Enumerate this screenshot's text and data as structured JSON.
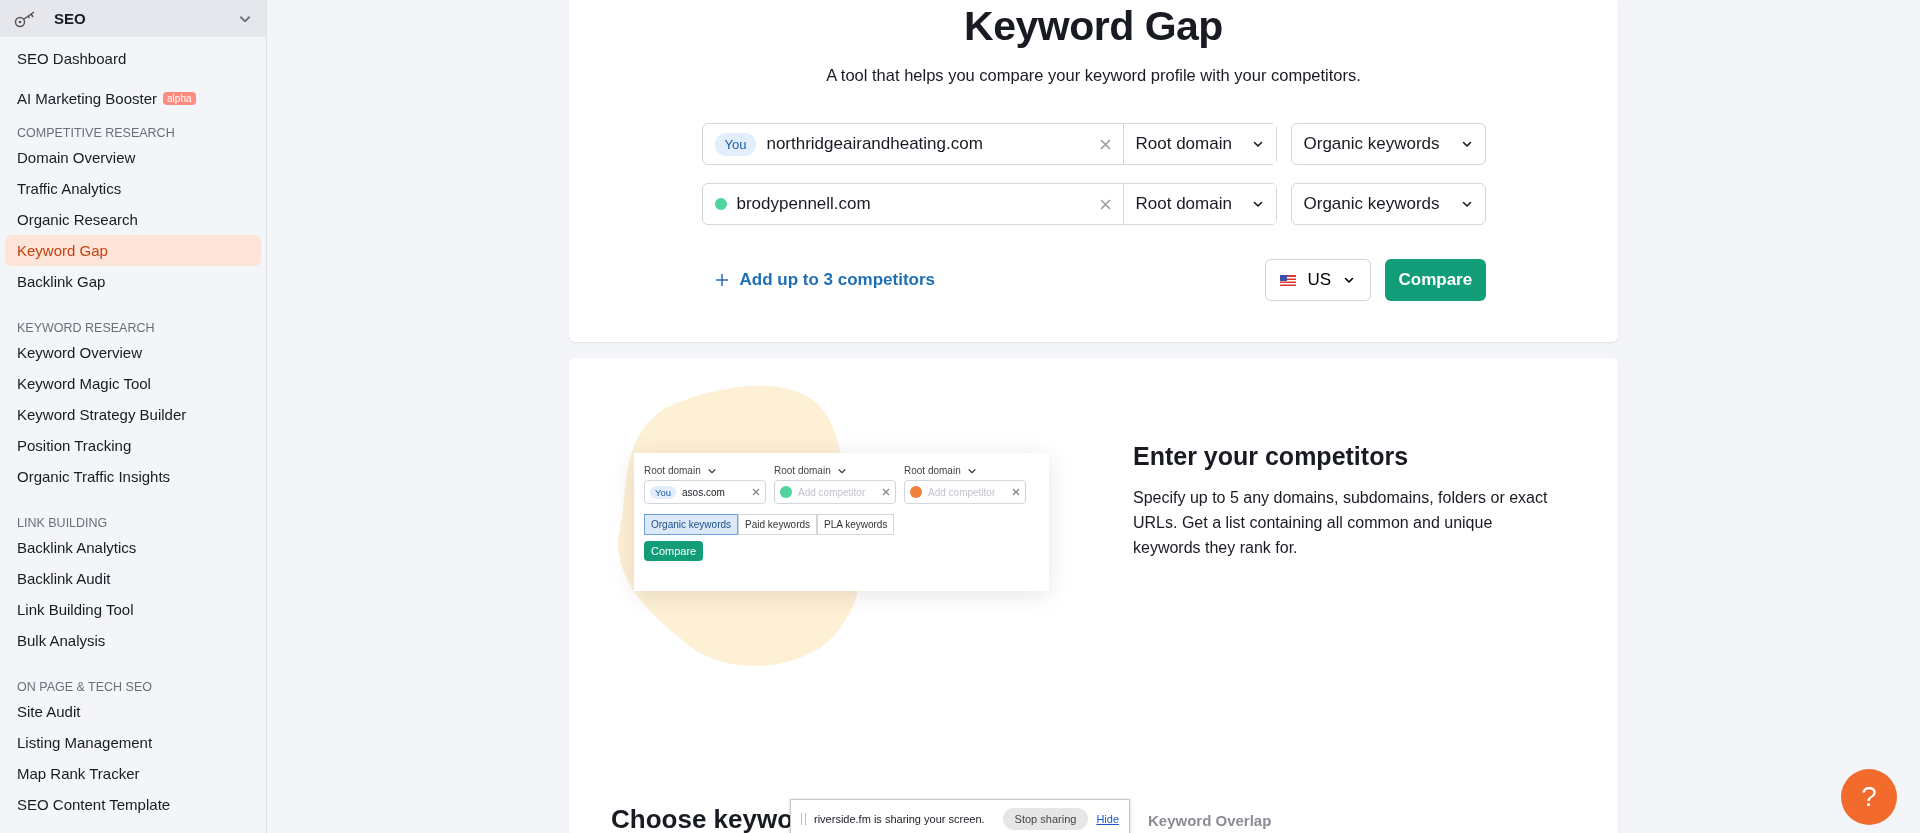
{
  "sidebar": {
    "section": "SEO",
    "items": [
      {
        "kind": "item",
        "label": "SEO Dashboard",
        "selected": false
      },
      {
        "kind": "item",
        "label": "AI Marketing Booster",
        "badge": "alpha",
        "selected": false
      },
      {
        "kind": "header",
        "label": "COMPETITIVE RESEARCH"
      },
      {
        "kind": "item",
        "label": "Domain Overview",
        "selected": false
      },
      {
        "kind": "item",
        "label": "Traffic Analytics",
        "selected": false
      },
      {
        "kind": "item",
        "label": "Organic Research",
        "selected": false
      },
      {
        "kind": "item",
        "label": "Keyword Gap",
        "selected": true
      },
      {
        "kind": "item",
        "label": "Backlink Gap",
        "selected": false
      },
      {
        "kind": "header",
        "label": "KEYWORD RESEARCH"
      },
      {
        "kind": "item",
        "label": "Keyword Overview",
        "selected": false
      },
      {
        "kind": "item",
        "label": "Keyword Magic Tool",
        "selected": false
      },
      {
        "kind": "item",
        "label": "Keyword Strategy Builder",
        "selected": false
      },
      {
        "kind": "item",
        "label": "Position Tracking",
        "selected": false
      },
      {
        "kind": "item",
        "label": "Organic Traffic Insights",
        "selected": false
      },
      {
        "kind": "header",
        "label": "LINK BUILDING"
      },
      {
        "kind": "item",
        "label": "Backlink Analytics",
        "selected": false
      },
      {
        "kind": "item",
        "label": "Backlink Audit",
        "selected": false
      },
      {
        "kind": "item",
        "label": "Link Building Tool",
        "selected": false
      },
      {
        "kind": "item",
        "label": "Bulk Analysis",
        "selected": false
      },
      {
        "kind": "header",
        "label": "ON PAGE & TECH SEO"
      },
      {
        "kind": "item",
        "label": "Site Audit",
        "selected": false
      },
      {
        "kind": "item",
        "label": "Listing Management",
        "selected": false
      },
      {
        "kind": "item",
        "label": "Map Rank Tracker",
        "selected": false
      },
      {
        "kind": "item",
        "label": "SEO Content Template",
        "selected": false
      }
    ]
  },
  "tool": {
    "title": "Keyword Gap",
    "subtitle": "A tool that helps you compare your keyword profile with your competitors.",
    "domains": [
      {
        "kind": "you",
        "tag": "You",
        "value": "northridgeairandheating.com",
        "scope": "Root domain",
        "type": "Organic keywords"
      },
      {
        "kind": "competitor",
        "color": "#4fd4a0",
        "value": "brodypennell.com",
        "scope": "Root domain",
        "type": "Organic keywords"
      }
    ],
    "add_link": "Add up to 3 competitors",
    "country": "US",
    "compare": "Compare"
  },
  "feature": {
    "heading": "Enter your competitors",
    "text": "Specify up to 5 any domains, subdomains, folders or exact URLs. Get a list containing all common and unique keywords they rank for.",
    "illustration": {
      "fields": [
        {
          "kind": "you",
          "scope": "Root domain",
          "tag": "You",
          "value": "asos.com"
        },
        {
          "kind": "competitor",
          "scope": "Root domain",
          "color": "#4fd4a0",
          "placeholder": "Add competitor"
        },
        {
          "kind": "competitor",
          "scope": "Root domain",
          "color": "#f0803c",
          "placeholder": "Add competitor"
        }
      ],
      "tabs": [
        {
          "label": "Organic keywords",
          "selected": true
        },
        {
          "label": "Paid keywords",
          "selected": false
        },
        {
          "label": "PLA keywords",
          "selected": false
        }
      ],
      "button": "Compare"
    }
  },
  "next_section": {
    "heading": "Choose keywo",
    "preview_title": "Keyword Overlap"
  },
  "share_bar": {
    "message": "riverside.fm is sharing your screen.",
    "stop": "Stop sharing",
    "hide": "Hide"
  },
  "help": "?"
}
